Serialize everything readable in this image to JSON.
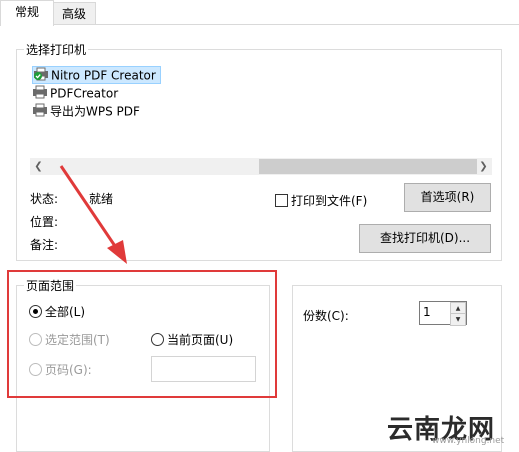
{
  "tabs": [
    {
      "label": "常规",
      "active": true
    },
    {
      "label": "高级",
      "active": false
    }
  ],
  "printer_group": {
    "legend": "选择打印机",
    "printers": [
      {
        "name": "Nitro PDF Creator",
        "selected": true,
        "default": true
      },
      {
        "name": "PDFCreator",
        "selected": false
      },
      {
        "name": "导出为WPS PDF",
        "selected": false
      }
    ],
    "status_label": "状态:",
    "status_value": "就绪",
    "location_label": "位置:",
    "comment_label": "备注:",
    "print_to_file": "打印到文件(F)",
    "prefs_button": "首选项(R)",
    "find_printer_button": "查找打印机(D)..."
  },
  "page_range": {
    "legend": "页面范围",
    "all": "全部(L)",
    "selection": "选定范围(T)",
    "current_page": "当前页面(U)",
    "pages": "页码(G):",
    "selected_option": "all"
  },
  "copies": {
    "label": "份数(C):",
    "value": "1"
  },
  "watermark": {
    "text": "云南龙网",
    "sub": "www.ynlong.net"
  },
  "colors": {
    "annotation": "#e03a3a",
    "selection": "#cce8ff"
  }
}
